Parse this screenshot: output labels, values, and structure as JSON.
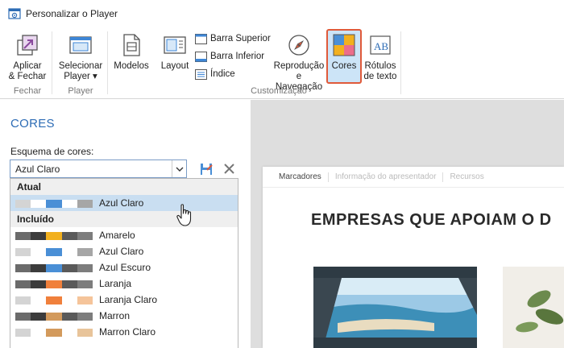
{
  "window": {
    "title": "Personalizar o Player"
  },
  "ribbon": {
    "groups": [
      {
        "label": "Fechar"
      },
      {
        "label": "Player"
      },
      {
        "label": "Customização"
      }
    ],
    "buttons": {
      "apply_close": {
        "line1": "Aplicar",
        "line2": "& Fechar"
      },
      "select_player": {
        "line1": "Selecionar",
        "line2": "Player ▾"
      },
      "templates": {
        "line1": "Modelos"
      },
      "layout": {
        "line1": "Layout"
      },
      "top_bar": {
        "label": "Barra Superior"
      },
      "bottom_bar": {
        "label": "Barra Inferior"
      },
      "index": {
        "label": "Índice"
      },
      "playback": {
        "line1": "Reprodução",
        "line2": "e Navegação"
      },
      "colors": {
        "line1": "Cores"
      },
      "text_labels": {
        "line1": "Rótulos",
        "line2": "de texto"
      }
    }
  },
  "panel": {
    "heading": "CORES",
    "scheme_label": "Esquema de cores:",
    "scheme_value": "Azul Claro",
    "dropdown": {
      "current_group": "Atual",
      "current_item": {
        "name": "Azul Claro",
        "colors": [
          "#d4d4d4",
          "#ffffff",
          "#4a8fd6",
          "#ffffff",
          "#a6a6a6"
        ]
      },
      "included_group": "Incluído",
      "items": [
        {
          "name": "Amarelo",
          "colors": [
            "#6b6b6b",
            "#3c3c3c",
            "#f2b01e",
            "#5a5a5a",
            "#7d7d7d"
          ]
        },
        {
          "name": "Azul Claro",
          "colors": [
            "#d4d4d4",
            "#ffffff",
            "#4a8fd6",
            "#ffffff",
            "#a6a6a6"
          ]
        },
        {
          "name": "Azul Escuro",
          "colors": [
            "#6b6b6b",
            "#3c3c3c",
            "#4a8fd6",
            "#5a5a5a",
            "#7d7d7d"
          ]
        },
        {
          "name": "Laranja",
          "colors": [
            "#6b6b6b",
            "#3c3c3c",
            "#f0803c",
            "#5a5a5a",
            "#7d7d7d"
          ]
        },
        {
          "name": "Laranja Claro",
          "colors": [
            "#d4d4d4",
            "#ffffff",
            "#f0803c",
            "#ffffff",
            "#f5c49a"
          ]
        },
        {
          "name": "Marron",
          "colors": [
            "#6b6b6b",
            "#3c3c3c",
            "#d39a5c",
            "#5a5a5a",
            "#7d7d7d"
          ]
        },
        {
          "name": "Marron Claro",
          "colors": [
            "#d4d4d4",
            "#ffffff",
            "#d39a5c",
            "#ffffff",
            "#e8c49a"
          ]
        }
      ]
    }
  },
  "preview": {
    "tabs": [
      "Marcadores",
      "Informação do apresentador",
      "Recursos"
    ],
    "heading": "EMPRESAS QUE APOIAM O D"
  },
  "colors": {
    "accent": "#2d6cb5",
    "selected_highlight": "#cce4f7",
    "selected_border": "#e05a3a"
  }
}
